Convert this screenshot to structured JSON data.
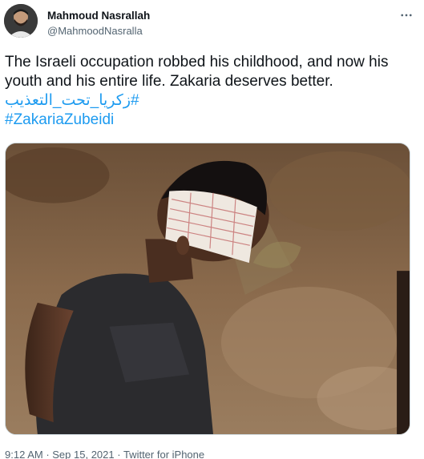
{
  "author": {
    "display_name": "Mahmoud Nasrallah",
    "handle": "@MahmoodNasralla"
  },
  "tweet": {
    "body": "The Israeli occupation robbed his childhood, and now his youth and his entire life. Zakaria deserves better.",
    "hashtags": [
      "#زكريا_تحت_التعذيب",
      "#ZakariaZubeidi"
    ]
  },
  "meta": {
    "time": "9:12 AM",
    "sep1": " · ",
    "date": "Sep 15, 2021",
    "sep2": " · ",
    "source": "Twitter for iPhone"
  },
  "colors": {
    "link": "#1d9bf0",
    "text": "#0f1419",
    "secondary": "#536471"
  },
  "icons": {
    "more": "more-horizontal-icon"
  }
}
